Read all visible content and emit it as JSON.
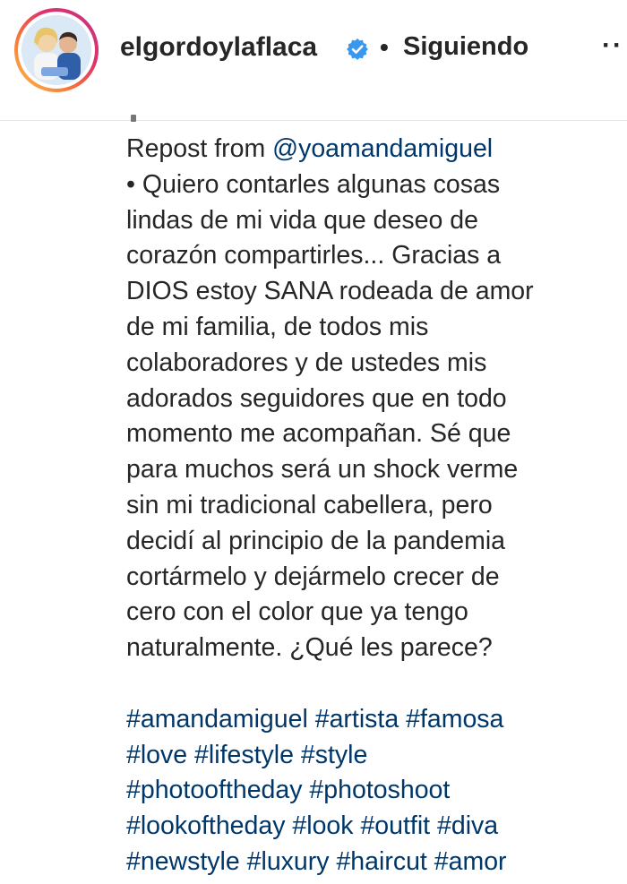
{
  "header": {
    "username": "elgordoylaflaca",
    "separator": "•",
    "follow_status": "Siguiendo",
    "more": "··"
  },
  "colors": {
    "link": "#00376b",
    "verified": "#3897f0",
    "text": "#262626"
  },
  "icons": {
    "verified": "verified-badge-icon",
    "more": "more-options-icon"
  },
  "caption": {
    "repost_prefix": "Repost from ",
    "repost_handle": "@yoamandamiguel",
    "lines": [
      "• Quiero contarles algunas cosas",
      "lindas de mi vida que deseo de",
      "corazón compartirles... Gracias a",
      "DIOS estoy SANA rodeada de amor",
      "de mi familia, de todos mis",
      "colaboradores y de ustedes mis",
      "adorados seguidores que en todo",
      "momento me acompañan. Sé que",
      "para muchos será un shock verme",
      "sin mi tradicional cabellera, pero",
      "decidí al principio de la pandemia",
      "cortármelo y dejármelo crecer de",
      "cero con el color que ya tengo",
      "naturalmente. ¿Qué les parece?"
    ],
    "hashtags": [
      "#amandamiguel #artista #famosa",
      "#love #lifestyle #style",
      "#photooftheday #photoshoot",
      "#lookoftheday #look #outfit #diva",
      "#newstyle #luxury #haircut #amor"
    ]
  }
}
